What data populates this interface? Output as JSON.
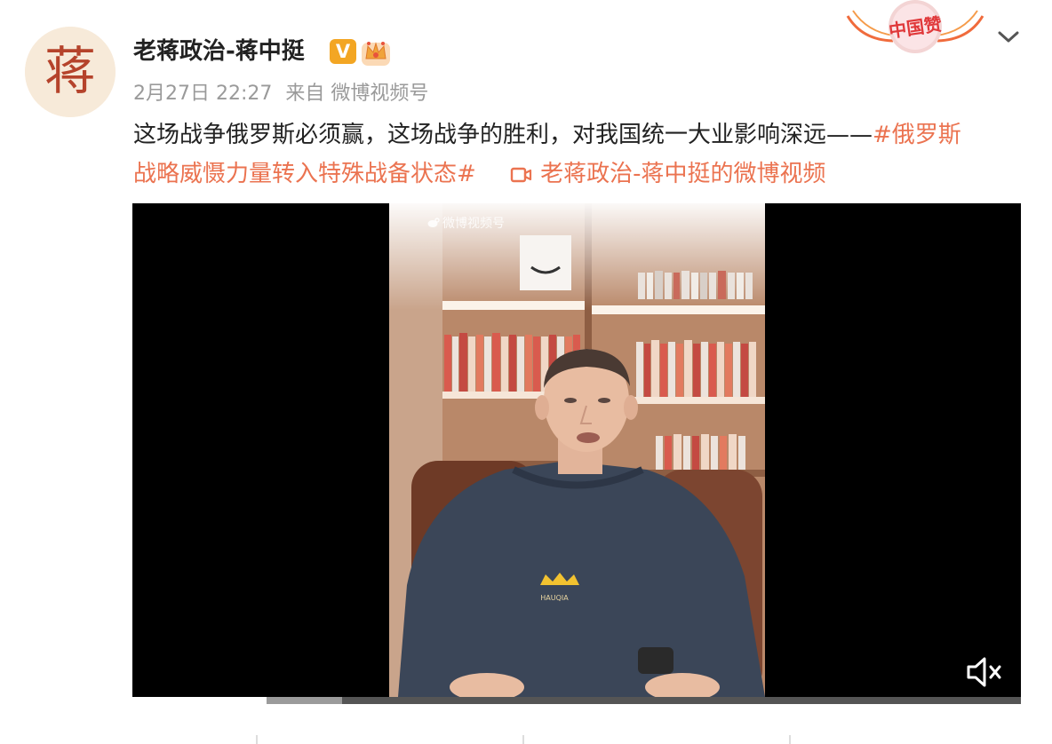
{
  "post": {
    "author_name": "老蒋政治-蒋中挺",
    "avatar_glyph": "蒋",
    "verified_badge": "V",
    "timestamp": "2月27日 22:27",
    "source": "来自 微博视频号",
    "text_part1": "这场战争俄罗斯必须赢，这场战争的胜利，对我国统一大业影响深远——",
    "hashtag_part1": "#俄罗斯",
    "hashtag_part2": "战略威慑力量转入特殊战备状态#",
    "video_link_text": "老蒋政治-蒋中挺的微博视频",
    "topic_badge_text": "中国赞"
  },
  "video": {
    "watermark": "微博视频号",
    "jacket_brand": "HAUQIA",
    "progress": 0.1
  },
  "icons": {
    "crown": "crown-icon",
    "chevron": "chevron-down-icon",
    "video_link": "video-link-icon",
    "mute": "volume-mute-icon"
  },
  "colors": {
    "link": "#eb7350",
    "text": "#222222",
    "meta": "#9a9a9a",
    "badge": "#f3a623"
  }
}
